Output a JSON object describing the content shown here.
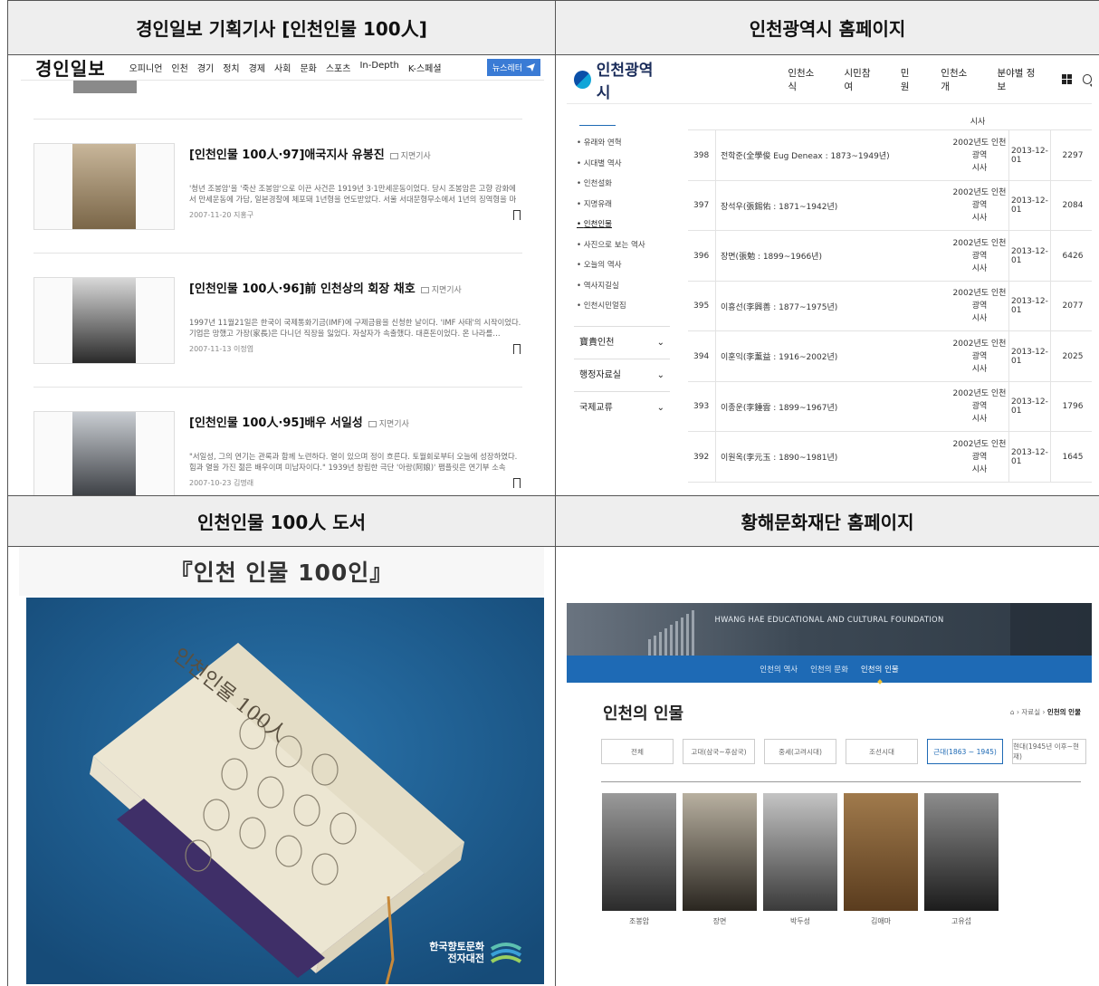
{
  "headers": {
    "top_left": "경인일보 기획기사 [인천인물 100人]",
    "top_right": "인천광역시 홈페이지",
    "bottom_left": "인천인물 100人 도서",
    "bottom_right": "황해문화재단 홈페이지"
  },
  "kyeongin": {
    "logo": "경인일보",
    "menu": [
      "오피니언",
      "인천",
      "경기",
      "정치",
      "경제",
      "사회",
      "문화",
      "스포츠",
      "In-Depth",
      "K-스페셜"
    ],
    "newsletter": "뉴스레터",
    "articles": [
      {
        "title": "[인천인물 100人·97]애국지사 유봉진",
        "tag": "지면기사",
        "body": "'청년 조봉암'을 '죽산 조봉암'으로 이끈 사건은 1919년 3·1만세운동이었다. 당시 조봉암은 고향 강화에서 만세운동에 가담, 일본경찰에 체포돼 1년형을 언도받았다. 서울 서대문형무소에서 1년의 징역형을 마치…",
        "date": "2007-11-20 지홍구"
      },
      {
        "title": "[인천인물 100人·96]前 인천상의 회장 채호",
        "tag": "지면기사",
        "body": "1997년 11월21일은 한국이 국제통화기금(IMF)에 구제금융을 신청한 날이다. 'IMF 사태'의 시작이었다. 기업은 망했고 가장(家長)은 다니던 직장을 잃었다. 자살자가 속출했다. 대혼돈이었다. 온 나라를…",
        "date": "2007-11-13 이정엽"
      },
      {
        "title": "[인천인물 100人·95]배우 서일성",
        "tag": "지면기사",
        "body": "\"서일성, 그의 연기는 관록과 함께 노련하다. 열이 있으며 정이 흐른다. 토월회로부터 오늘에 성장하였다. 힘과 열을 가진 젊은 배우이며 미남자이다.\" 1939년 창립한 극단 '아랑(阿娘)' 팸플릿은 연기부 소속 배…",
        "date": "2007-10-23 김명래"
      }
    ]
  },
  "incheon": {
    "logo": "인천광역시",
    "menu": [
      "인천소식",
      "시민참여",
      "민원",
      "인천소개",
      "분야별 정보"
    ],
    "side_sub": [
      "유래와 연혁",
      "시대별 역사",
      "인천설화",
      "지명유래",
      "인천인물",
      "사진으로 보는 역사",
      "오늘의 역사",
      "역사지길실",
      "인천시민얼짐"
    ],
    "side_active_index": 4,
    "side_big": [
      "寶貴인천",
      "행정자료실",
      "국제교류"
    ],
    "partial_row_dept": "시사",
    "rows": [
      {
        "no": "398",
        "name": "전학준(全學俊 Eug Deneax : 1873~1949년)",
        "dept1": "2002년도 인천광역",
        "dept2": "시사",
        "date": "2013-12-01",
        "views": "2297"
      },
      {
        "no": "397",
        "name": "장석우(張錫佑 : 1871~1942년)",
        "dept1": "2002년도 인천광역",
        "dept2": "시사",
        "date": "2013-12-01",
        "views": "2084"
      },
      {
        "no": "396",
        "name": "장면(張勉 : 1899~1966년)",
        "dept1": "2002년도 인천광역",
        "dept2": "시사",
        "date": "2013-12-01",
        "views": "6426"
      },
      {
        "no": "395",
        "name": "이흥선(李興善 : 1877~1975년)",
        "dept1": "2002년도 인천광역",
        "dept2": "시사",
        "date": "2013-12-01",
        "views": "2077"
      },
      {
        "no": "394",
        "name": "이훈익(李薰益 : 1916~2002년)",
        "dept1": "2002년도 인천광역",
        "dept2": "시사",
        "date": "2013-12-01",
        "views": "2025"
      },
      {
        "no": "393",
        "name": "이종운(李鍾雲 : 1899~1967년)",
        "dept1": "2002년도 인천광역",
        "dept2": "시사",
        "date": "2013-12-01",
        "views": "1796"
      },
      {
        "no": "392",
        "name": "이원옥(李元玉 : 1890~1981년)",
        "dept1": "2002년도 인천광역",
        "dept2": "시사",
        "date": "2013-12-01",
        "views": "1645"
      }
    ]
  },
  "book": {
    "title": "『인천 인물 100인』",
    "logo_line1": "한국향토문화",
    "logo_line2": "전자대전",
    "cover_title": "인천인물 100人"
  },
  "hwanghae": {
    "foundation": "HWANG HAE EDUCATIONAL AND CULTURAL FOUNDATION",
    "tabs": [
      "인천의 역사",
      "인천의 문화",
      "인천의 인물"
    ],
    "active_tab_index": 2,
    "heading": "인천의 인물",
    "breadcrumb_prefix": "자료실",
    "breadcrumb_current": "인천의 인물",
    "eras": [
      "전체",
      "고대(삼국~후삼국)",
      "중세(고려시대)",
      "조선시대",
      "근대(1863 ~ 1945)",
      "현대(1945년 이후~현재)"
    ],
    "active_era_index": 4,
    "people": [
      "조봉암",
      "장면",
      "박두성",
      "김애마",
      "고유섭"
    ]
  }
}
